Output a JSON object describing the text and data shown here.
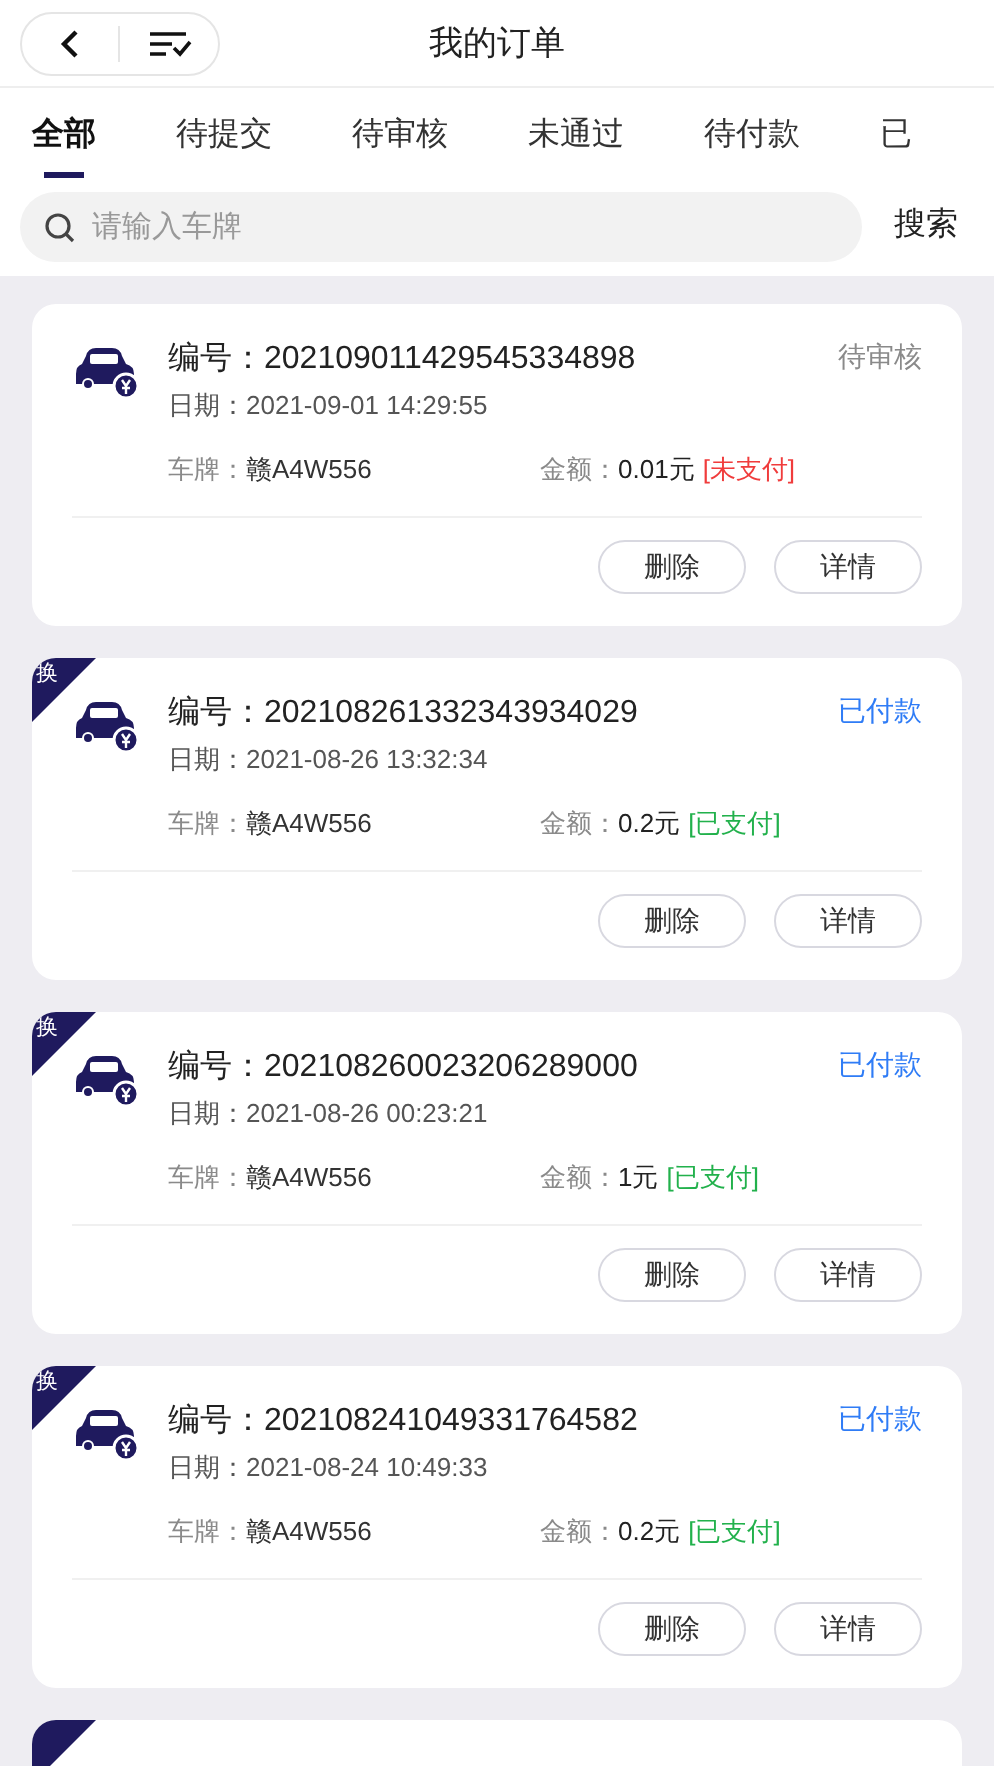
{
  "header": {
    "title": "我的订单"
  },
  "tabs": [
    {
      "label": "全部",
      "selected": true
    },
    {
      "label": "待提交",
      "selected": false
    },
    {
      "label": "待审核",
      "selected": false
    },
    {
      "label": "未通过",
      "selected": false
    },
    {
      "label": "待付款",
      "selected": false
    },
    {
      "label": "已",
      "selected": false
    }
  ],
  "search": {
    "placeholder": "请输入车牌",
    "button": "搜索"
  },
  "orders": [
    {
      "number": "编号：202109011429545334898",
      "date": "日期：2021-09-01 14:29:55",
      "status": {
        "text": "待审核",
        "color": "#8a8a8a"
      },
      "plate_label": "车牌：",
      "plate": "赣A4W556",
      "amount_label": "金额：",
      "amount": "0.01元",
      "payment": {
        "text": "[未支付]",
        "color": "#f03c3c"
      },
      "actions": [
        "删除",
        "详情"
      ]
    },
    {
      "badge": "换",
      "number": "编号：202108261332343934029",
      "date": "日期：2021-08-26 13:32:34",
      "status": {
        "text": "已付款",
        "color": "#2f7cf6"
      },
      "plate_label": "车牌：",
      "plate": "赣A4W556",
      "amount_label": "金额：",
      "amount": "0.2元",
      "payment": {
        "text": "[已支付]",
        "color": "#22b14c"
      },
      "actions": [
        "删除",
        "详情"
      ]
    },
    {
      "badge": "换",
      "number": "编号：202108260023206289000",
      "date": "日期：2021-08-26 00:23:21",
      "status": {
        "text": "已付款",
        "color": "#2f7cf6"
      },
      "plate_label": "车牌：",
      "plate": "赣A4W556",
      "amount_label": "金额：",
      "amount": "1元",
      "payment": {
        "text": "[已支付]",
        "color": "#22b14c"
      },
      "actions": [
        "删除",
        "详情"
      ]
    },
    {
      "badge": "换",
      "number": "编号：202108241049331764582",
      "date": "日期：2021-08-24 10:49:33",
      "status": {
        "text": "已付款",
        "color": "#2f7cf6"
      },
      "plate_label": "车牌：",
      "plate": "赣A4W556",
      "amount_label": "金额：",
      "amount": "0.2元",
      "payment": {
        "text": "[已支付]",
        "color": "#22b14c"
      },
      "actions": [
        "删除",
        "详情"
      ]
    }
  ]
}
